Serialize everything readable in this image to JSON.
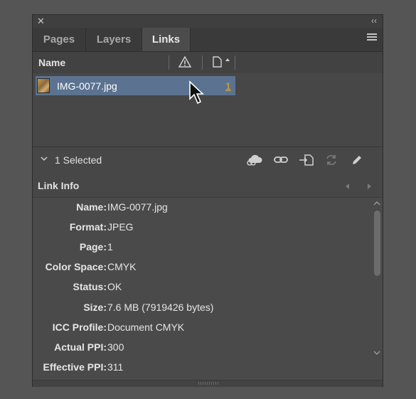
{
  "tabs": [
    {
      "label": "Pages"
    },
    {
      "label": "Layers"
    },
    {
      "label": "Links"
    }
  ],
  "list": {
    "column_name": "Name",
    "rows": [
      {
        "name": "IMG-0077.jpg",
        "page": "1"
      }
    ]
  },
  "toolbar": {
    "selection_text": "1 Selected"
  },
  "link_info": {
    "title": "Link Info",
    "fields": [
      {
        "label": "Name:",
        "value": "IMG-0077.jpg"
      },
      {
        "label": "Format:",
        "value": "JPEG"
      },
      {
        "label": "Page:",
        "value": "1"
      },
      {
        "label": "Color Space:",
        "value": "CMYK"
      },
      {
        "label": "Status:",
        "value": "OK"
      },
      {
        "label": "Size:",
        "value": "7.6 MB (7919426 bytes)"
      },
      {
        "label": "ICC Profile:",
        "value": "Document CMYK"
      },
      {
        "label": "Actual PPI:",
        "value": "300"
      },
      {
        "label": "Effective PPI:",
        "value": "311"
      }
    ]
  },
  "icons": {
    "close": "close-icon",
    "collapse": "collapse-icon",
    "panel_menu": "panel-menu-icon",
    "warning": "warning-icon",
    "page_sort": "page-sort-icon",
    "toolbar": [
      "cloud-link-icon",
      "relink-icon",
      "go-to-link-icon",
      "update-link-icon",
      "edit-original-icon"
    ]
  },
  "colors": {
    "selection": "#5b7390",
    "page_link": "#e7a82a"
  }
}
